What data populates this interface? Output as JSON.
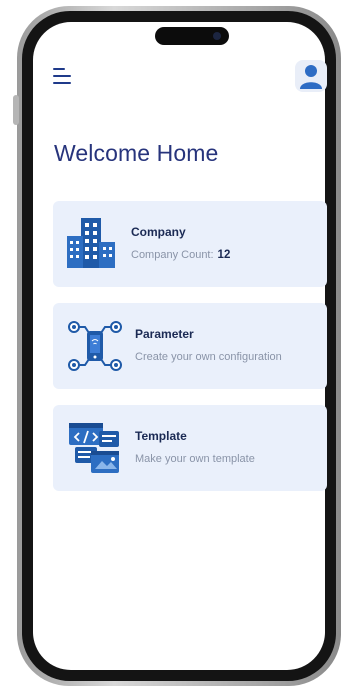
{
  "header": {
    "title": "Welcome Home",
    "menu_icon": "hamburger-menu-icon",
    "profile_icon": "user-icon"
  },
  "cards": [
    {
      "title": "Company",
      "description": "Company Count:",
      "count": "12",
      "icon": "building-icon"
    },
    {
      "title": "Parameter",
      "description": "Create your own configuration",
      "icon": "circuit-config-icon"
    },
    {
      "title": "Template",
      "description": "Make your own template",
      "icon": "template-layout-icon"
    }
  ],
  "colors": {
    "accent": "#27347c",
    "icon_blue": "#1f5aa8",
    "card_bg": "#eaf0fb"
  }
}
